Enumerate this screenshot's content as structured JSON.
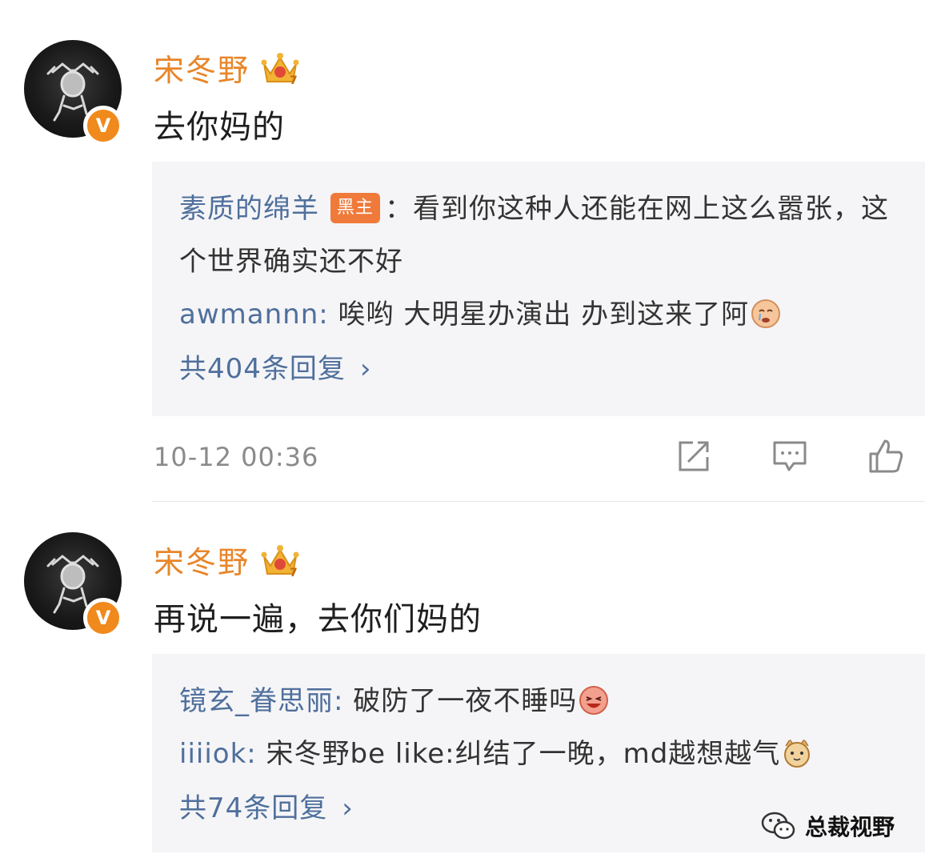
{
  "comments": [
    {
      "username": "宋冬野",
      "verified_badge": "V",
      "text": "去你妈的",
      "replies": [
        {
          "name": "素质的绵羊",
          "badge": "黑主",
          "sep": "：",
          "text": "看到你这种人还能在网上这么嚣张，这个世界确实还不好",
          "emoji": null
        },
        {
          "name": "awmannn",
          "sep": ": ",
          "text": "唉哟 大明星办演出 办到这来了阿",
          "emoji": "crying-face-emoji"
        }
      ],
      "more_replies": "共404条回复",
      "timestamp": "10-12 00:36"
    },
    {
      "username": "宋冬野",
      "verified_badge": "V",
      "text": "再说一遍，去你们妈的",
      "replies": [
        {
          "name": "镜玄_眷思丽",
          "sep": ": ",
          "text": "破防了一夜不睡吗",
          "emoji": "laughing-face-emoji"
        },
        {
          "name": "iiiiok",
          "sep": ": ",
          "text": "宋冬野be like:纠结了一晚，md越想越气",
          "emoji": "cat-face-emoji"
        }
      ],
      "more_replies": "共74条回复"
    }
  ],
  "icons": [
    "crown-icon",
    "verified-badge-icon",
    "share-icon",
    "comment-icon",
    "like-icon",
    "chevron-right-icon",
    "wechat-icon"
  ],
  "watermark": "总裁视野",
  "colors": {
    "username": "#e8862a",
    "reply_name": "#4f6f9c",
    "reply_bg": "#f5f5f7",
    "badge": "#f08a1c"
  }
}
